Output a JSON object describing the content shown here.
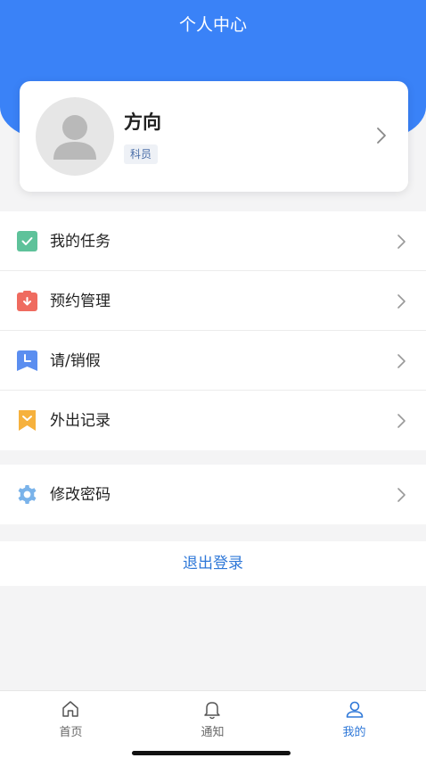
{
  "header": {
    "title": "个人中心"
  },
  "profile": {
    "name": "方向",
    "role": "科员"
  },
  "menu_group_1": [
    {
      "label": "我的任务",
      "icon": "task-check-icon",
      "color": "#5ec29a"
    },
    {
      "label": "预约管理",
      "icon": "appointment-icon",
      "color": "#ef6b5f"
    },
    {
      "label": "请/销假",
      "icon": "leave-clock-icon",
      "color": "#5b8ef0"
    },
    {
      "label": "外出记录",
      "icon": "outing-record-icon",
      "color": "#f6b13d"
    }
  ],
  "menu_group_2": [
    {
      "label": "修改密码",
      "icon": "gear-icon",
      "color": "#7ab3ea"
    }
  ],
  "logout": {
    "label": "退出登录"
  },
  "tabbar": {
    "tabs": [
      {
        "label": "首页",
        "icon": "home-icon",
        "active": false
      },
      {
        "label": "通知",
        "icon": "bell-icon",
        "active": false
      },
      {
        "label": "我的",
        "icon": "user-icon",
        "active": true
      }
    ]
  },
  "colors": {
    "brand": "#3a82f7",
    "link": "#2f78d8",
    "background": "#f4f4f5"
  }
}
